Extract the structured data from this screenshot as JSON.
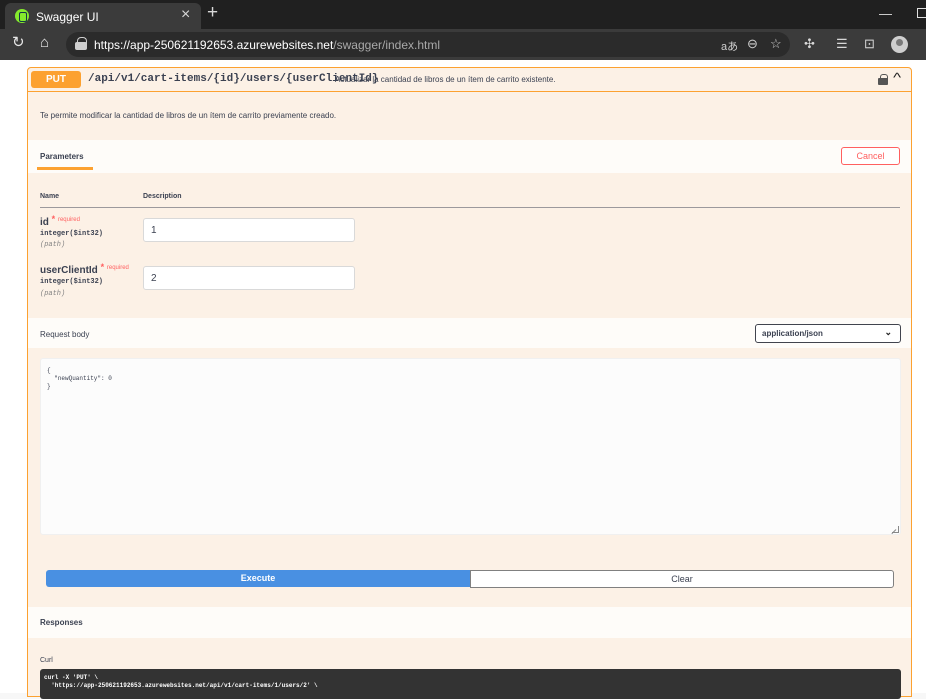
{
  "browser": {
    "tab_title": "Swagger UI",
    "tab_close": "×",
    "new_tab": "+",
    "url_host": "https://app-250621192653.azurewebsites.net",
    "url_path": "/swagger/index.html",
    "icons": [
      "refresh-icon",
      "home-icon",
      "lock-icon",
      "read-aloud-icon",
      "zoom-icon",
      "favorite-star-icon",
      "extensions-icon",
      "favorites-icon",
      "screenshot-icon",
      "profile-avatar"
    ]
  },
  "operation": {
    "method": "PUT",
    "path": "/api/v1/cart-items/{id}/users/{userClientId}",
    "summary": "Actualizar la cantidad de libros de un ítem de carrito existente.",
    "description": "Te permite modificar la cantidad de libros de un ítem de carrito previamente creado.",
    "method_color": "#fca130"
  },
  "parameters": {
    "tab_label": "Parameters",
    "cancel_label": "Cancel",
    "col_name": "Name",
    "col_description": "Description",
    "items": [
      {
        "name": "id",
        "star": "*",
        "required": "required",
        "type": "integer($int32)",
        "in": "(path)",
        "value": "1"
      },
      {
        "name": "userClientId",
        "star": "*",
        "required": "required",
        "type": "integer($int32)",
        "in": "(path)",
        "value": "2"
      }
    ]
  },
  "request_body": {
    "label": "Request body",
    "content_type": "application/json",
    "lines": [
      "{",
      "  \"newQuantity\": 0",
      "}"
    ]
  },
  "actions": {
    "execute_label": "Execute",
    "clear_label": "Clear",
    "execute_color": "#4990e2"
  },
  "responses": {
    "label": "Responses",
    "curl_label": "Curl",
    "curl_lines": [
      "curl -X 'PUT' \\",
      "  'https://app-250621192653.azurewebsites.net/api/v1/cart-items/1/users/2' \\"
    ]
  }
}
